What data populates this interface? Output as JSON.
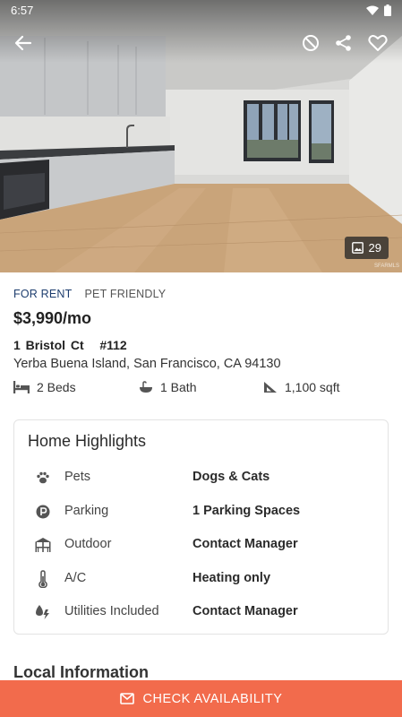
{
  "status_bar": {
    "time": "6:57"
  },
  "gallery": {
    "photo_count": "29",
    "watermark": "SFARMLS"
  },
  "listing": {
    "tags": [
      "FOR RENT",
      "PET FRIENDLY"
    ],
    "price": "$3,990/mo",
    "street": "1 Bristol Ct   #112",
    "city_line": "Yerba Buena Island, San Francisco, CA 94130",
    "specs": {
      "beds": "2 Beds",
      "baths": "1 Bath",
      "area": "1,100 sqft"
    }
  },
  "highlights": {
    "title": "Home Highlights",
    "rows": [
      {
        "icon": "paw-icon",
        "label": "Pets",
        "value": "Dogs & Cats"
      },
      {
        "icon": "parking-icon",
        "label": "Parking",
        "value": "1 Parking Spaces"
      },
      {
        "icon": "outdoor-icon",
        "label": "Outdoor",
        "value": "Contact Manager"
      },
      {
        "icon": "thermometer-icon",
        "label": "A/C",
        "value": "Heating only"
      },
      {
        "icon": "utilities-icon",
        "label": "Utilities Included",
        "value": "Contact Manager"
      }
    ]
  },
  "local_information": {
    "title": "Local Information"
  },
  "cta": {
    "label": "CHECK AVAILABILITY"
  },
  "colors": {
    "accent": "#f26b4c",
    "tag_blue": "#1d3d6e"
  }
}
